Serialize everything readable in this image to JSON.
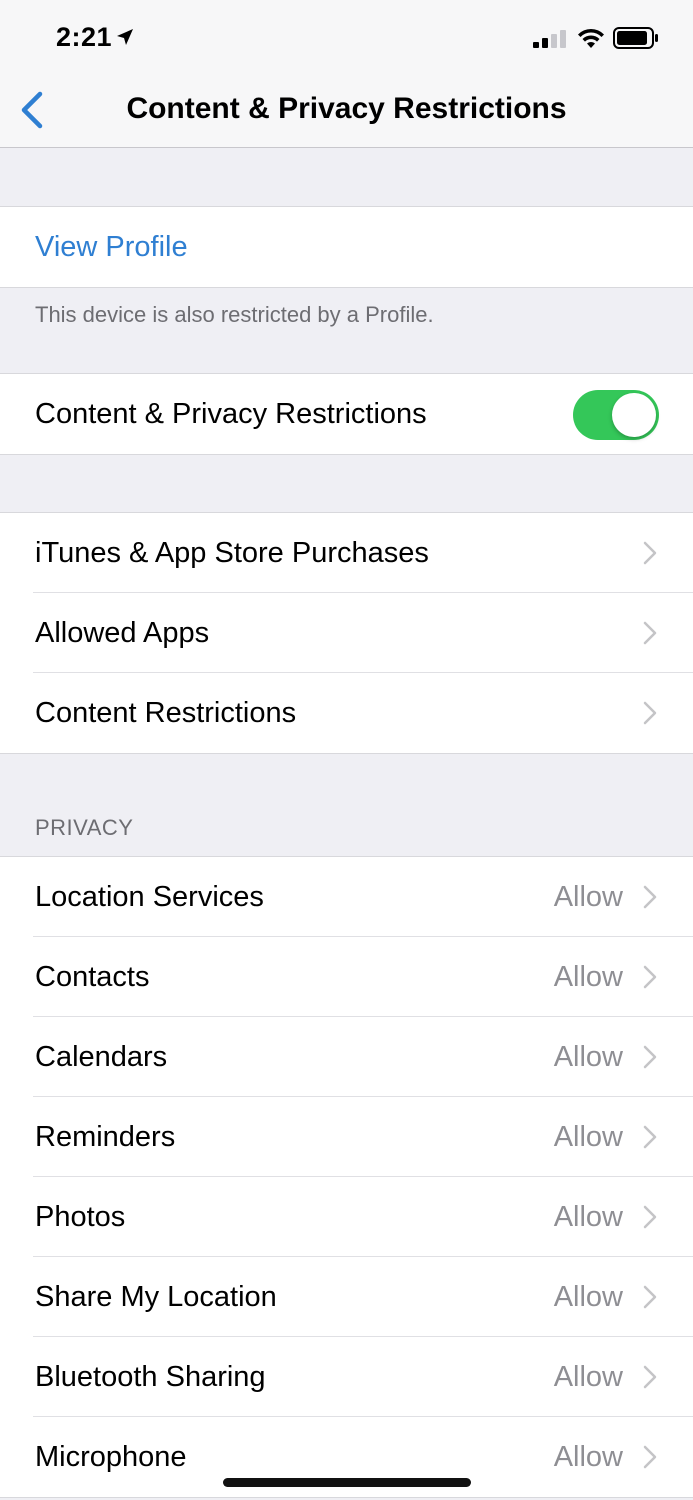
{
  "status_bar": {
    "time": "2:21"
  },
  "nav": {
    "title": "Content & Privacy Restrictions"
  },
  "profile": {
    "link_label": "View Profile",
    "footnote": "This device is also restricted by a Profile."
  },
  "master_toggle": {
    "label": "Content & Privacy Restrictions",
    "on": true
  },
  "store_group": {
    "items": [
      {
        "label": "iTunes & App Store Purchases"
      },
      {
        "label": "Allowed Apps"
      },
      {
        "label": "Content Restrictions"
      }
    ]
  },
  "privacy": {
    "header": "PRIVACY",
    "items": [
      {
        "label": "Location Services",
        "value": "Allow"
      },
      {
        "label": "Contacts",
        "value": "Allow"
      },
      {
        "label": "Calendars",
        "value": "Allow"
      },
      {
        "label": "Reminders",
        "value": "Allow"
      },
      {
        "label": "Photos",
        "value": "Allow"
      },
      {
        "label": "Share My Location",
        "value": "Allow"
      },
      {
        "label": "Bluetooth Sharing",
        "value": "Allow"
      },
      {
        "label": "Microphone",
        "value": "Allow"
      }
    ]
  },
  "colors": {
    "accent": "#2f7fd2",
    "toggle_on": "#34c759",
    "background": "#efeff4"
  }
}
